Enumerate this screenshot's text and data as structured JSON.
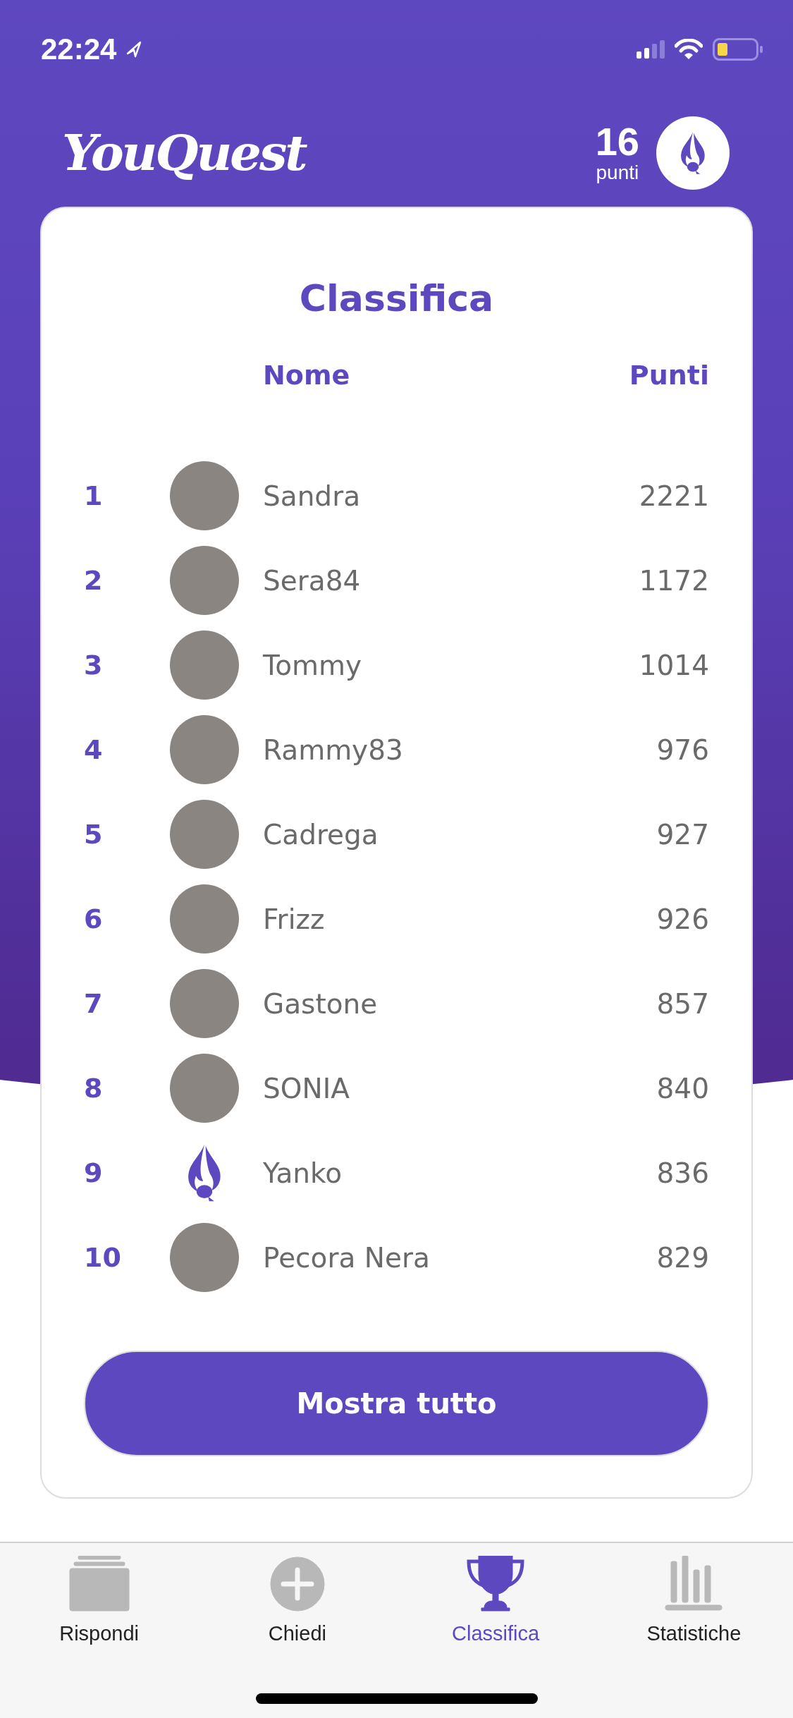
{
  "status_bar": {
    "time": "22:24"
  },
  "header": {
    "logo": "YouQuest",
    "points": "16",
    "points_label": "punti"
  },
  "leaderboard": {
    "title": "Classifica",
    "columns": [
      "Nome",
      "Punti"
    ],
    "rows": [
      {
        "rank": "1",
        "name": "Sandra",
        "points": "2221",
        "kind": "photo"
      },
      {
        "rank": "2",
        "name": "Sera84",
        "points": "1172",
        "kind": "photo"
      },
      {
        "rank": "3",
        "name": "Tommy",
        "points": "1014",
        "kind": "photo"
      },
      {
        "rank": "4",
        "name": "Rammy83",
        "points": "976",
        "kind": "photo"
      },
      {
        "rank": "5",
        "name": "Cadrega",
        "points": "927",
        "kind": "photo"
      },
      {
        "rank": "6",
        "name": "Frizz",
        "points": "926",
        "kind": "photo"
      },
      {
        "rank": "7",
        "name": "Gastone",
        "points": "857",
        "kind": "photo"
      },
      {
        "rank": "8",
        "name": "SONIA",
        "points": "840",
        "kind": "photo"
      },
      {
        "rank": "9",
        "name": "Yanko",
        "points": "836",
        "kind": "logo"
      },
      {
        "rank": "10",
        "name": "Pecora Nera",
        "points": "829",
        "kind": "photo"
      }
    ],
    "button": "Mostra tutto"
  },
  "tab_bar": [
    {
      "label": "Rispondi",
      "selected": false
    },
    {
      "label": "Chiedi",
      "selected": false
    },
    {
      "label": "Classifica",
      "selected": true
    },
    {
      "label": "Statistiche",
      "selected": false
    }
  ]
}
